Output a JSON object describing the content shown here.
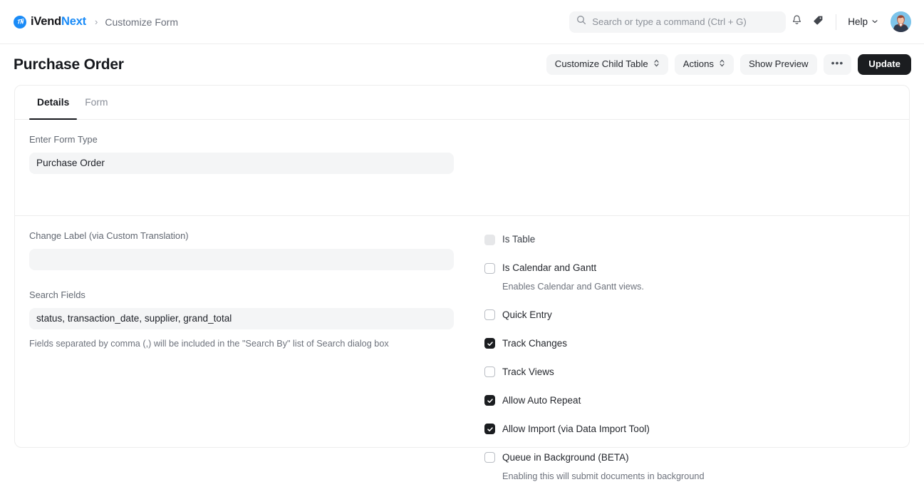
{
  "navbar": {
    "brand_prefix": "iVend",
    "brand_suffix": "Next",
    "brand_logo_icon": "ivendnext-logo-icon",
    "breadcrumb_separator": "›",
    "breadcrumb_current": "Customize Form",
    "search": {
      "icon": "search-icon",
      "placeholder": "Search or type a command (Ctrl + G)",
      "value": ""
    },
    "notifications_icon": "bell-icon",
    "tags_icon": "tag-icon",
    "help_label": "Help",
    "help_chevron_icon": "chevron-down-icon",
    "avatar_icon": "user-avatar"
  },
  "page": {
    "title": "Purchase Order",
    "actions": [
      {
        "label": "Customize Child Table",
        "icon": "select-chevrons-icon",
        "type": "select"
      },
      {
        "label": "Actions",
        "icon": "select-chevrons-icon",
        "type": "select"
      },
      {
        "label": "Show Preview",
        "icon": "",
        "type": "button"
      },
      {
        "label": "•••",
        "icon": "ellipsis-icon",
        "type": "menu"
      },
      {
        "label": "Update",
        "icon": "",
        "type": "primary"
      }
    ]
  },
  "tabs": [
    {
      "label": "Details",
      "active": true
    },
    {
      "label": "Form",
      "active": false
    }
  ],
  "form": {
    "form_type": {
      "label": "Enter Form Type",
      "value": "Purchase Order",
      "placeholder": ""
    },
    "change_label": {
      "label": "Change Label (via Custom Translation)",
      "value": "",
      "placeholder": ""
    },
    "search_fields": {
      "label": "Search Fields",
      "value": "status, transaction_date, supplier, grand_total",
      "placeholder": "",
      "help": "Fields separated by comma (,) will be included in the \"Search By\" list of Search dialog box"
    }
  },
  "options": [
    {
      "label": "Is Table",
      "checked": false,
      "disabled": true,
      "help": ""
    },
    {
      "label": "Is Calendar and Gantt",
      "checked": false,
      "disabled": false,
      "help": "Enables Calendar and Gantt views."
    },
    {
      "label": "Quick Entry",
      "checked": false,
      "disabled": false,
      "help": ""
    },
    {
      "label": "Track Changes",
      "checked": true,
      "disabled": false,
      "help": ""
    },
    {
      "label": "Track Views",
      "checked": false,
      "disabled": false,
      "help": ""
    },
    {
      "label": "Allow Auto Repeat",
      "checked": true,
      "disabled": false,
      "help": ""
    },
    {
      "label": "Allow Import (via Data Import Tool)",
      "checked": true,
      "disabled": false,
      "help": ""
    },
    {
      "label": "Queue in Background (BETA)",
      "checked": false,
      "disabled": false,
      "help": "Enabling this will submit documents in background"
    }
  ],
  "colors": {
    "brand_blue": "#1a8bf7",
    "primary_dark": "#1b1d20",
    "field_bg": "#f4f5f6",
    "border": "#ededed",
    "text_muted": "#6d727c"
  }
}
